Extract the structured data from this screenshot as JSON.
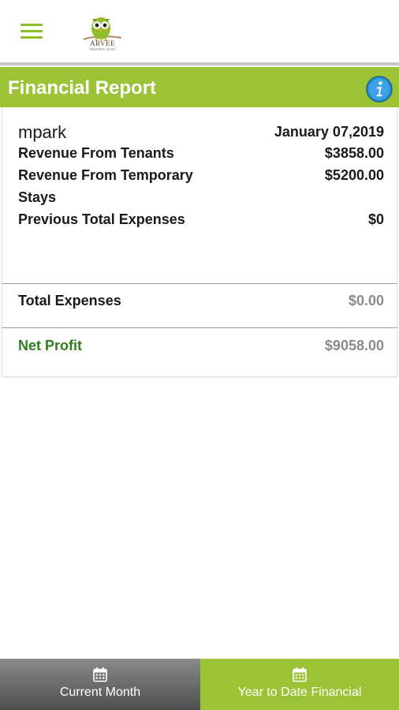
{
  "app": {
    "logo_text": "ARVEE",
    "logo_subtext": "PROPERTY MGMT"
  },
  "header": {
    "title": "Financial Report",
    "info_icon": "info-icon"
  },
  "report": {
    "username": "mpark",
    "date": "January 07,2019",
    "rows": [
      {
        "label": "Revenue From Tenants",
        "value": "$3858.00"
      },
      {
        "label": "Revenue From Temporary Stays",
        "value": "$5200.00"
      },
      {
        "label": "Previous Total Expenses",
        "value": "$0"
      }
    ],
    "total_expenses": {
      "label": "Total Expenses",
      "value": "$0.00"
    },
    "net_profit": {
      "label": "Net Profit",
      "value": "$9058.00"
    }
  },
  "bottom_nav": {
    "tabs": [
      {
        "label": "Current Month",
        "icon": "calendar-icon"
      },
      {
        "label": "Year to Date Financial",
        "icon": "calendar-icon"
      }
    ]
  },
  "colors": {
    "accent": "#9ac436",
    "profit": "#2f7d1f",
    "info": "#2b8fd6"
  }
}
